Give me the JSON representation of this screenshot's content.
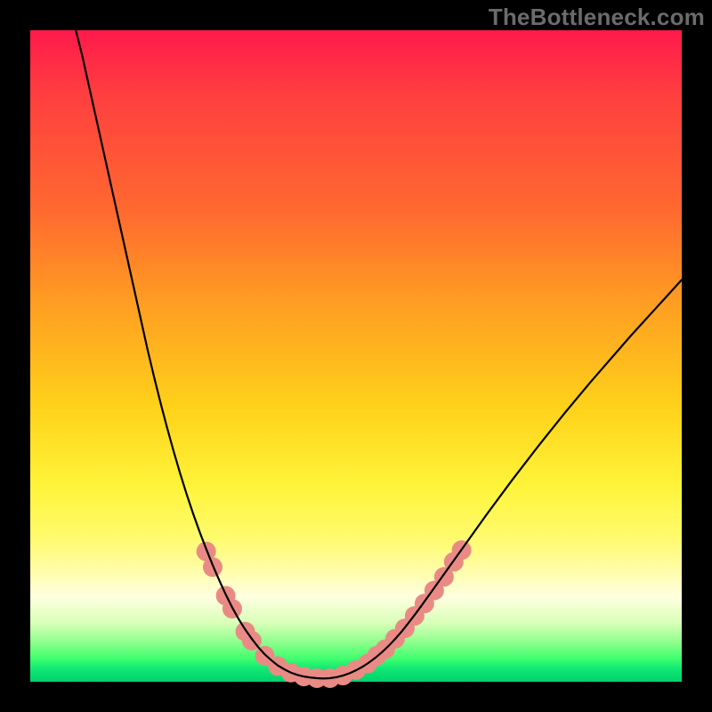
{
  "watermark": "TheBottleneck.com",
  "chart_data": {
    "type": "line",
    "title": "",
    "xlabel": "",
    "ylabel": "",
    "xlim": [
      0,
      100
    ],
    "ylim": [
      0,
      100
    ],
    "grid": false,
    "legend": false,
    "series": [
      {
        "name": "curve",
        "color": "#000000",
        "stroke_width": 2.2,
        "points": [
          [
            7,
            100
          ],
          [
            8,
            96
          ],
          [
            9,
            91.5
          ],
          [
            10,
            87
          ],
          [
            11,
            82.5
          ],
          [
            12,
            78
          ],
          [
            13,
            73.5
          ],
          [
            14,
            69
          ],
          [
            15,
            64.5
          ],
          [
            16,
            60
          ],
          [
            17,
            55.5
          ],
          [
            18,
            51
          ],
          [
            19,
            46.8
          ],
          [
            20,
            42.8
          ],
          [
            21,
            39
          ],
          [
            22,
            35.4
          ],
          [
            23,
            32
          ],
          [
            24,
            28.8
          ],
          [
            25,
            25.8
          ],
          [
            26,
            23
          ],
          [
            27,
            20.4
          ],
          [
            28,
            17.9
          ],
          [
            29,
            15.6
          ],
          [
            30,
            13.4
          ],
          [
            31,
            11.4
          ],
          [
            32,
            9.6
          ],
          [
            33,
            8
          ],
          [
            34,
            6.6
          ],
          [
            35,
            5.3
          ],
          [
            36,
            4.2
          ],
          [
            37,
            3.3
          ],
          [
            38,
            2.5
          ],
          [
            39,
            1.9
          ],
          [
            40,
            1.4
          ],
          [
            41,
            1.05
          ],
          [
            42,
            0.8
          ],
          [
            43,
            0.65
          ],
          [
            44,
            0.55
          ],
          [
            45,
            0.5
          ],
          [
            46,
            0.55
          ],
          [
            47,
            0.7
          ],
          [
            48,
            0.95
          ],
          [
            49,
            1.3
          ],
          [
            50,
            1.75
          ],
          [
            51,
            2.3
          ],
          [
            52,
            2.95
          ],
          [
            53,
            3.7
          ],
          [
            54,
            4.55
          ],
          [
            55,
            5.5
          ],
          [
            56,
            6.55
          ],
          [
            57,
            7.7
          ],
          [
            58,
            8.95
          ],
          [
            59,
            10.25
          ],
          [
            60,
            11.6
          ],
          [
            62,
            14.4
          ],
          [
            64,
            17.2
          ],
          [
            66,
            20
          ],
          [
            68,
            22.8
          ],
          [
            70,
            25.6
          ],
          [
            72,
            28.3
          ],
          [
            74,
            31
          ],
          [
            76,
            33.6
          ],
          [
            78,
            36.2
          ],
          [
            80,
            38.7
          ],
          [
            82,
            41.2
          ],
          [
            84,
            43.6
          ],
          [
            86,
            46
          ],
          [
            88,
            48.3
          ],
          [
            90,
            50.6
          ],
          [
            92,
            52.9
          ],
          [
            94,
            55.1
          ],
          [
            96,
            57.3
          ],
          [
            98,
            59.5
          ],
          [
            100,
            61.7
          ]
        ]
      },
      {
        "name": "highlight-dots",
        "color": "#e98b84",
        "marker_radius": 11,
        "points": [
          [
            27,
            20.0
          ],
          [
            28,
            17.6
          ],
          [
            30,
            13.2
          ],
          [
            31,
            11.2
          ],
          [
            33,
            7.7
          ],
          [
            34,
            6.3
          ],
          [
            36,
            4.0
          ],
          [
            38,
            2.4
          ],
          [
            40,
            1.4
          ],
          [
            42,
            0.8
          ],
          [
            44,
            0.55
          ],
          [
            46,
            0.55
          ],
          [
            48,
            0.95
          ],
          [
            50,
            1.8
          ],
          [
            51.8,
            2.8
          ],
          [
            53.2,
            4.0
          ],
          [
            54.5,
            5.0
          ],
          [
            56,
            6.6
          ],
          [
            57.5,
            8.2
          ],
          [
            59,
            10.1
          ],
          [
            60.5,
            12.0
          ],
          [
            62,
            14.0
          ],
          [
            63.5,
            16.1
          ],
          [
            65,
            18.4
          ],
          [
            66.2,
            20.2
          ]
        ]
      }
    ]
  }
}
